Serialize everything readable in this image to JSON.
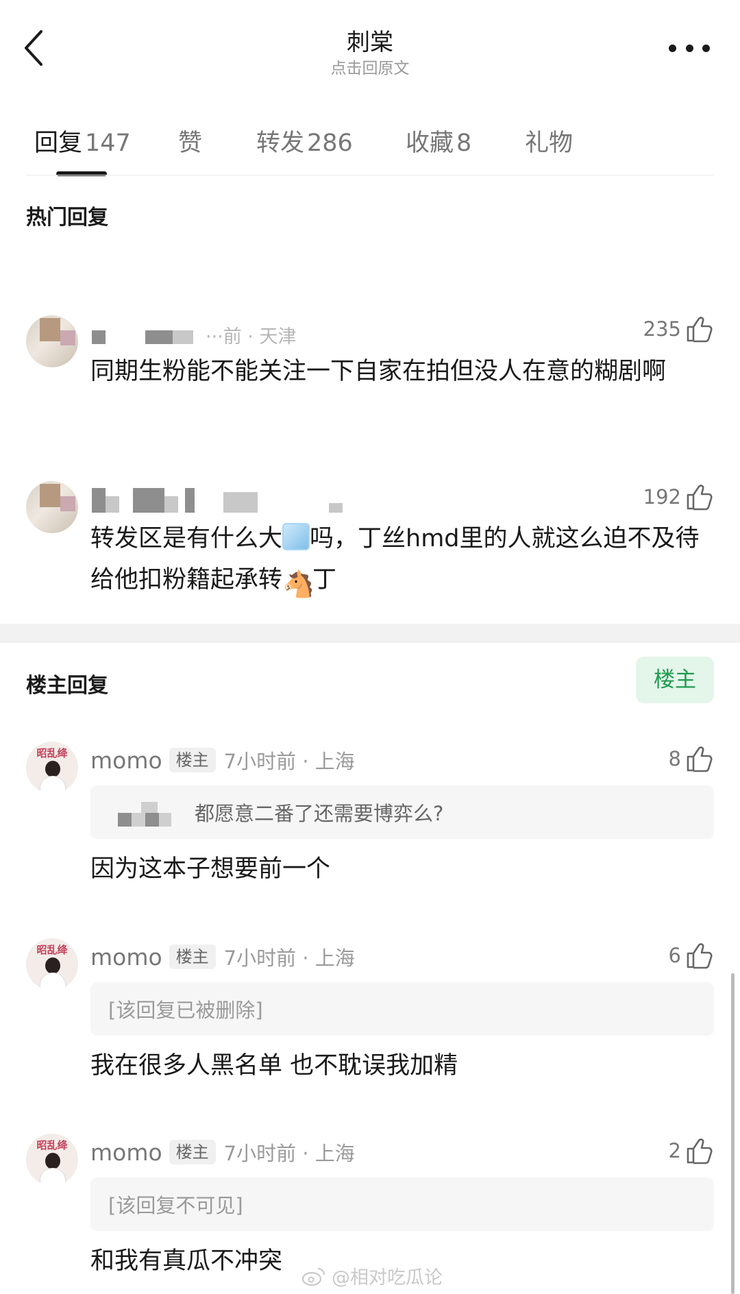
{
  "header": {
    "title": "刺棠",
    "subtitle": "点击回原文"
  },
  "tabs": [
    {
      "label": "回复",
      "count": "147",
      "active": true
    },
    {
      "label": "赞",
      "count": ""
    },
    {
      "label": "转发",
      "count": "286"
    },
    {
      "label": "收藏",
      "count": "8"
    },
    {
      "label": "礼物",
      "count": ""
    }
  ],
  "hot_section": {
    "title": "热门回复",
    "comments": [
      {
        "meta_partial": "···前 · 天津",
        "likes": "235",
        "text": "同期生粉能不能关注一下自家在拍但没人在意的糊剧啊"
      },
      {
        "likes": "192",
        "text_part1": "转发区是有什么大",
        "text_part2": "吗，丁丝hmd里的人就这么迫不及待给他扣粉籍起承转",
        "text_part3": "丁",
        "emoji_1": "ice-cube-emoji",
        "emoji_2": "horse-emoji"
      }
    ]
  },
  "op_section": {
    "title": "楼主回复",
    "filter_button": "楼主",
    "comments": [
      {
        "username": "momo",
        "badge": "楼主",
        "time_loc": "7小时前 · 上海",
        "likes": "8",
        "quote": "都愿意二番了还需要博弈么?",
        "text": "因为这本子想要前一个"
      },
      {
        "username": "momo",
        "badge": "楼主",
        "time_loc": "7小时前 · 上海",
        "likes": "6",
        "quote": "[该回复已被删除]",
        "text": "我在很多人黑名单 也不耽误我加精"
      },
      {
        "username": "momo",
        "badge": "楼主",
        "time_loc": "7小时前 · 上海",
        "likes": "2",
        "quote": "[该回复不可见]",
        "text": "和我有真瓜不冲突"
      }
    ],
    "avatar_text": "昭乱绛"
  },
  "watermark": "@相对吃瓜论"
}
